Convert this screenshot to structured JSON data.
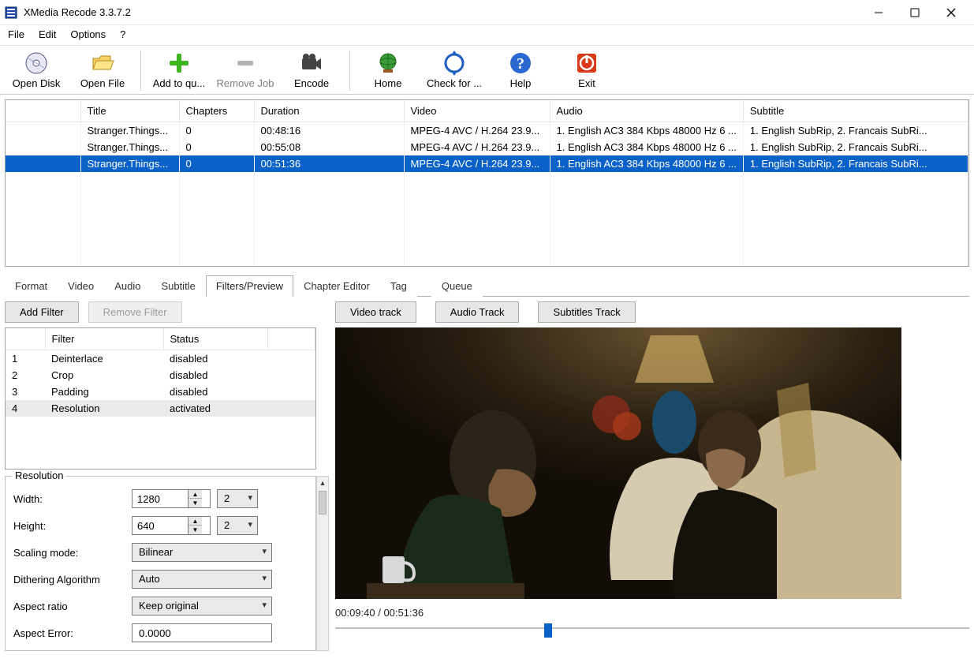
{
  "app": {
    "title": "XMedia Recode 3.3.7.2"
  },
  "menu": {
    "file": "File",
    "edit": "Edit",
    "options": "Options",
    "help": "?"
  },
  "toolbar": {
    "open_disk": "Open Disk",
    "open_file": "Open File",
    "add_queue": "Add to qu...",
    "remove_job": "Remove Job",
    "encode": "Encode",
    "home": "Home",
    "check_update": "Check for ...",
    "help": "Help",
    "exit": "Exit"
  },
  "media": {
    "headers": {
      "title": "Title",
      "chapters": "Chapters",
      "duration": "Duration",
      "video": "Video",
      "audio": "Audio",
      "subtitle": "Subtitle"
    },
    "rows": [
      {
        "title": "Stranger.Things...",
        "chapters": "0",
        "duration": "00:48:16",
        "video": "MPEG-4 AVC / H.264 23.9...",
        "audio": "1. English AC3 384 Kbps 48000 Hz 6 ...",
        "subtitle": "1. English SubRip, 2. Francais SubRi..."
      },
      {
        "title": "Stranger.Things...",
        "chapters": "0",
        "duration": "00:55:08",
        "video": "MPEG-4 AVC / H.264 23.9...",
        "audio": "1. English AC3 384 Kbps 48000 Hz 6 ...",
        "subtitle": "1. English SubRip, 2. Francais SubRi..."
      },
      {
        "title": "Stranger.Things...",
        "chapters": "0",
        "duration": "00:51:36",
        "video": "MPEG-4 AVC / H.264 23.9...",
        "audio": "1. English AC3 384 Kbps 48000 Hz 6 ...",
        "subtitle": "1. English SubRip, 2. Francais SubRi..."
      }
    ],
    "selected_index": 2
  },
  "tabs": {
    "format": "Format",
    "video": "Video",
    "audio": "Audio",
    "subtitle": "Subtitle",
    "filters": "Filters/Preview",
    "chapter": "Chapter Editor",
    "tag": "Tag",
    "queue": "Queue"
  },
  "filter_panel": {
    "add_filter": "Add Filter",
    "remove_filter": "Remove Filter",
    "headers": {
      "idx": "",
      "filter": "Filter",
      "status": "Status"
    },
    "rows": [
      {
        "idx": "1",
        "name": "Deinterlace",
        "status": "disabled"
      },
      {
        "idx": "2",
        "name": "Crop",
        "status": "disabled"
      },
      {
        "idx": "3",
        "name": "Padding",
        "status": "disabled"
      },
      {
        "idx": "4",
        "name": "Resolution",
        "status": "activated"
      }
    ],
    "selected_index": 3
  },
  "resolution": {
    "legend": "Resolution",
    "width_label": "Width:",
    "width_value": "1280",
    "width_step": "2",
    "height_label": "Height:",
    "height_value": "640",
    "height_step": "2",
    "scaling_label": "Scaling mode:",
    "scaling_value": "Bilinear",
    "dither_label": "Dithering Algorithm",
    "dither_value": "Auto",
    "aspect_label": "Aspect ratio",
    "aspect_value": "Keep original",
    "aspect_err_label": "Aspect Error:",
    "aspect_err_value": "0.0000"
  },
  "tracks": {
    "video": "Video track",
    "audio": "Audio Track",
    "subtitles": "Subtitles Track"
  },
  "timeline": {
    "label": "00:09:40 / 00:51:36",
    "pos_percent": 33
  }
}
